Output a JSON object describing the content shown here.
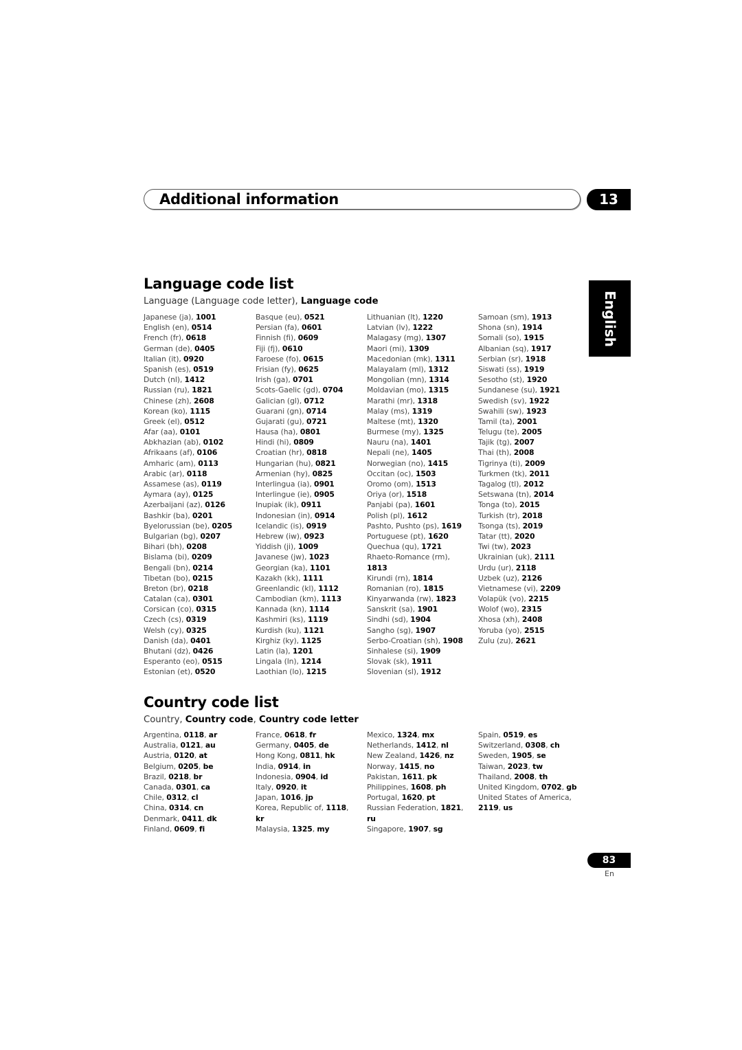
{
  "header": {
    "title": "Additional information",
    "chapter_number": "13"
  },
  "language_tab": "English",
  "language_section": {
    "title": "Language code list",
    "subtitle_plain": "Language (Language code letter), ",
    "subtitle_bold": "Language code",
    "columns": [
      [
        {
          "name": "Japanese (ja), ",
          "code": "1001"
        },
        {
          "name": "English (en), ",
          "code": "0514"
        },
        {
          "name": "French (fr), ",
          "code": "0618"
        },
        {
          "name": "German (de), ",
          "code": "0405"
        },
        {
          "name": "Italian (it), ",
          "code": "0920"
        },
        {
          "name": "Spanish (es), ",
          "code": "0519"
        },
        {
          "name": "Dutch (nl), ",
          "code": "1412"
        },
        {
          "name": "Russian (ru), ",
          "code": "1821"
        },
        {
          "name": "Chinese (zh), ",
          "code": "2608"
        },
        {
          "name": "Korean (ko), ",
          "code": "1115"
        },
        {
          "name": "Greek (el), ",
          "code": "0512"
        },
        {
          "name": "Afar (aa), ",
          "code": "0101"
        },
        {
          "name": "Abkhazian (ab), ",
          "code": "0102"
        },
        {
          "name": "Afrikaans (af), ",
          "code": "0106"
        },
        {
          "name": "Amharic (am), ",
          "code": "0113"
        },
        {
          "name": "Arabic (ar), ",
          "code": "0118"
        },
        {
          "name": "Assamese (as), ",
          "code": "0119"
        },
        {
          "name": "Aymara (ay), ",
          "code": "0125"
        },
        {
          "name": "Azerbaijani (az), ",
          "code": "0126"
        },
        {
          "name": "Bashkir (ba), ",
          "code": "0201"
        },
        {
          "name": "Byelorussian (be), ",
          "code": "0205"
        },
        {
          "name": "Bulgarian (bg), ",
          "code": "0207"
        },
        {
          "name": "Bihari (bh), ",
          "code": "0208"
        },
        {
          "name": "Bislama (bi), ",
          "code": "0209"
        },
        {
          "name": "Bengali (bn), ",
          "code": "0214"
        },
        {
          "name": "Tibetan (bo), ",
          "code": "0215"
        },
        {
          "name": "Breton (br), ",
          "code": "0218"
        },
        {
          "name": "Catalan (ca), ",
          "code": "0301"
        },
        {
          "name": "Corsican (co), ",
          "code": "0315"
        },
        {
          "name": "Czech (cs), ",
          "code": "0319"
        },
        {
          "name": "Welsh (cy), ",
          "code": "0325"
        },
        {
          "name": "Danish (da), ",
          "code": "0401"
        },
        {
          "name": "Bhutani (dz), ",
          "code": "0426"
        },
        {
          "name": "Esperanto (eo), ",
          "code": "0515"
        },
        {
          "name": "Estonian (et), ",
          "code": "0520"
        }
      ],
      [
        {
          "name": "Basque (eu), ",
          "code": "0521"
        },
        {
          "name": "Persian (fa), ",
          "code": "0601"
        },
        {
          "name": "Finnish (fi), ",
          "code": "0609"
        },
        {
          "name": "Fiji (fj), ",
          "code": "0610"
        },
        {
          "name": "Faroese (fo), ",
          "code": "0615"
        },
        {
          "name": "Frisian (fy), ",
          "code": "0625"
        },
        {
          "name": "Irish (ga), ",
          "code": "0701"
        },
        {
          "name": "Scots-Gaelic (gd), ",
          "code": "0704"
        },
        {
          "name": "Galician (gl), ",
          "code": "0712"
        },
        {
          "name": "Guarani (gn), ",
          "code": "0714"
        },
        {
          "name": "Gujarati (gu), ",
          "code": "0721"
        },
        {
          "name": "Hausa (ha), ",
          "code": "0801"
        },
        {
          "name": "Hindi (hi), ",
          "code": "0809"
        },
        {
          "name": "Croatian (hr), ",
          "code": "0818"
        },
        {
          "name": "Hungarian (hu), ",
          "code": "0821"
        },
        {
          "name": "Armenian (hy), ",
          "code": "0825"
        },
        {
          "name": "Interlingua (ia), ",
          "code": "0901"
        },
        {
          "name": "Interlingue (ie), ",
          "code": "0905"
        },
        {
          "name": "Inupiak (ik), ",
          "code": "0911"
        },
        {
          "name": "Indonesian (in), ",
          "code": "0914"
        },
        {
          "name": "Icelandic (is), ",
          "code": "0919"
        },
        {
          "name": "Hebrew (iw), ",
          "code": "0923"
        },
        {
          "name": "Yiddish (ji), ",
          "code": "1009"
        },
        {
          "name": "Javanese (jw), ",
          "code": "1023"
        },
        {
          "name": "Georgian (ka), ",
          "code": "1101"
        },
        {
          "name": "Kazakh (kk), ",
          "code": "1111"
        },
        {
          "name": "Greenlandic  (kl), ",
          "code": "1112"
        },
        {
          "name": "Cambodian (km), ",
          "code": "1113"
        },
        {
          "name": "Kannada (kn), ",
          "code": "1114"
        },
        {
          "name": "Kashmiri (ks), ",
          "code": "1119"
        },
        {
          "name": "Kurdish (ku), ",
          "code": "1121"
        },
        {
          "name": "Kirghiz (ky), ",
          "code": "1125"
        },
        {
          "name": "Latin (la), ",
          "code": "1201"
        },
        {
          "name": "Lingala (ln), ",
          "code": "1214"
        },
        {
          "name": "Laothian (lo), ",
          "code": "1215"
        }
      ],
      [
        {
          "name": "Lithuanian (lt), ",
          "code": "1220"
        },
        {
          "name": "Latvian (lv), ",
          "code": "1222"
        },
        {
          "name": "Malagasy (mg), ",
          "code": "1307"
        },
        {
          "name": "Maori (mi), ",
          "code": "1309"
        },
        {
          "name": "Macedonian (mk), ",
          "code": "1311"
        },
        {
          "name": "Malayalam  (ml), ",
          "code": "1312"
        },
        {
          "name": "Mongolian (mn), ",
          "code": "1314"
        },
        {
          "name": "Moldavian (mo), ",
          "code": "1315"
        },
        {
          "name": "Marathi (mr), ",
          "code": "1318"
        },
        {
          "name": "Malay  (ms), ",
          "code": "1319"
        },
        {
          "name": "Maltese (mt), ",
          "code": "1320"
        },
        {
          "name": "Burmese (my), ",
          "code": "1325"
        },
        {
          "name": "Nauru (na), ",
          "code": "1401"
        },
        {
          "name": "Nepali (ne), ",
          "code": "1405"
        },
        {
          "name": "Norwegian (no), ",
          "code": "1415"
        },
        {
          "name": "Occitan (oc), ",
          "code": "1503"
        },
        {
          "name": "Oromo (om), ",
          "code": "1513"
        },
        {
          "name": "Oriya (or), ",
          "code": "1518"
        },
        {
          "name": "Panjabi (pa), ",
          "code": "1601"
        },
        {
          "name": "Polish (pl), ",
          "code": "1612"
        },
        {
          "name": "Pashto, Pushto (ps), ",
          "code": "1619"
        },
        {
          "name": "Portuguese (pt), ",
          "code": "1620"
        },
        {
          "name": "Quechua (qu), ",
          "code": "1721"
        },
        {
          "name": "Rhaeto-Romance (rm), ",
          "code": "1813",
          "wrap": true
        },
        {
          "name": "Kirundi (rn), ",
          "code": "1814"
        },
        {
          "name": "Romanian (ro), ",
          "code": "1815"
        },
        {
          "name": "Kinyarwanda (rw), ",
          "code": "1823"
        },
        {
          "name": "Sanskrit (sa), ",
          "code": "1901"
        },
        {
          "name": "Sindhi (sd), ",
          "code": "1904"
        },
        {
          "name": "Sangho (sg), ",
          "code": "1907"
        },
        {
          "name": "Serbo-Croatian (sh), ",
          "code": "1908"
        },
        {
          "name": "Sinhalese (si), ",
          "code": "1909"
        },
        {
          "name": "Slovak (sk), ",
          "code": "1911"
        },
        {
          "name": "Slovenian (sl), ",
          "code": "1912"
        }
      ],
      [
        {
          "name": "Samoan (sm), ",
          "code": "1913"
        },
        {
          "name": "Shona (sn), ",
          "code": "1914"
        },
        {
          "name": "Somali (so), ",
          "code": "1915"
        },
        {
          "name": "Albanian (sq), ",
          "code": "1917"
        },
        {
          "name": "Serbian (sr), ",
          "code": "1918"
        },
        {
          "name": "Siswati (ss), ",
          "code": "1919"
        },
        {
          "name": "Sesotho (st), ",
          "code": "1920"
        },
        {
          "name": "Sundanese (su), ",
          "code": "1921"
        },
        {
          "name": "Swedish (sv), ",
          "code": "1922"
        },
        {
          "name": "Swahili (sw), ",
          "code": "1923"
        },
        {
          "name": "Tamil (ta), ",
          "code": "2001"
        },
        {
          "name": "Telugu (te), ",
          "code": "2005"
        },
        {
          "name": "Tajik (tg), ",
          "code": "2007"
        },
        {
          "name": "Thai (th), ",
          "code": "2008"
        },
        {
          "name": "Tigrinya (ti), ",
          "code": "2009"
        },
        {
          "name": "Turkmen (tk), ",
          "code": "2011"
        },
        {
          "name": "Tagalog (tl), ",
          "code": "2012"
        },
        {
          "name": "Setswana (tn), ",
          "code": "2014"
        },
        {
          "name": "Tonga (to), ",
          "code": "2015"
        },
        {
          "name": "Turkish (tr), ",
          "code": "2018"
        },
        {
          "name": "Tsonga (ts), ",
          "code": "2019"
        },
        {
          "name": "Tatar (tt), ",
          "code": "2020"
        },
        {
          "name": "Twi (tw), ",
          "code": "2023"
        },
        {
          "name": "Ukrainian (uk), ",
          "code": "2111"
        },
        {
          "name": "Urdu (ur), ",
          "code": "2118"
        },
        {
          "name": "Uzbek (uz), ",
          "code": "2126"
        },
        {
          "name": "Vietnamese (vi), ",
          "code": "2209"
        },
        {
          "name": "Volapük (vo), ",
          "code": "2215"
        },
        {
          "name": "Wolof (wo), ",
          "code": "2315"
        },
        {
          "name": "Xhosa (xh), ",
          "code": "2408"
        },
        {
          "name": "Yoruba (yo), ",
          "code": "2515"
        },
        {
          "name": "Zulu (zu), ",
          "code": "2621"
        }
      ]
    ]
  },
  "country_section": {
    "title": "Country code list",
    "subtitle_plain": "Country, ",
    "subtitle_bold1": "Country code",
    "subtitle_sep": ", ",
    "subtitle_bold2": "Country code letter",
    "columns": [
      [
        {
          "name": "Argentina, ",
          "code": "0118",
          "letter": "ar"
        },
        {
          "name": "Australia, ",
          "code": "0121",
          "letter": "au"
        },
        {
          "name": "Austria, ",
          "code": "0120",
          "letter": "at"
        },
        {
          "name": "Belgium, ",
          "code": "0205",
          "letter": "be"
        },
        {
          "name": "Brazil, ",
          "code": "0218",
          "letter": "br"
        },
        {
          "name": "Canada, ",
          "code": "0301",
          "letter": "ca"
        },
        {
          "name": "Chile, ",
          "code": "0312",
          "letter": "cl"
        },
        {
          "name": "China, ",
          "code": "0314",
          "letter": "cn"
        },
        {
          "name": "Denmark, ",
          "code": "0411",
          "letter": "dk"
        },
        {
          "name": "Finland, ",
          "code": "0609",
          "letter": "fi"
        }
      ],
      [
        {
          "name": "France, ",
          "code": "0618",
          "letter": "fr"
        },
        {
          "name": "Germany, ",
          "code": "0405",
          "letter": "de"
        },
        {
          "name": "Hong Kong, ",
          "code": "0811",
          "letter": "hk"
        },
        {
          "name": "India, ",
          "code": "0914",
          "letter": "in"
        },
        {
          "name": "Indonesia, ",
          "code": "0904",
          "letter": "id"
        },
        {
          "name": "Italy, ",
          "code": "0920",
          "letter": "it"
        },
        {
          "name": "Japan, ",
          "code": "1016",
          "letter": "jp"
        },
        {
          "name": "Korea, Republic of, ",
          "code": "1118",
          "letter": "kr",
          "wrap": true
        },
        {
          "name": "Malaysia, ",
          "code": "1325",
          "letter": "my"
        }
      ],
      [
        {
          "name": "Mexico, ",
          "code": "1324",
          "letter": "mx"
        },
        {
          "name": "Netherlands, ",
          "code": "1412",
          "letter": "nl"
        },
        {
          "name": "New Zealand, ",
          "code": "1426",
          "letter": "nz"
        },
        {
          "name": "Norway, ",
          "code": "1415",
          "letter": "no"
        },
        {
          "name": "Pakistan, ",
          "code": "1611",
          "letter": "pk"
        },
        {
          "name": "Philippines, ",
          "code": "1608",
          "letter": "ph"
        },
        {
          "name": "Portugal, ",
          "code": "1620",
          "letter": "pt"
        },
        {
          "name": "Russian Federation, ",
          "code": "1821",
          "letter": "ru",
          "wrap": true
        },
        {
          "name": "Singapore, ",
          "code": "1907",
          "letter": "sg"
        }
      ],
      [
        {
          "name": "Spain, ",
          "code": "0519",
          "letter": "es"
        },
        {
          "name": "Switzerland, ",
          "code": "0308",
          "letter": "ch"
        },
        {
          "name": "Sweden, ",
          "code": "1905",
          "letter": "se"
        },
        {
          "name": "Taiwan, ",
          "code": "2023",
          "letter": "tw"
        },
        {
          "name": "Thailand, ",
          "code": "2008",
          "letter": "th"
        },
        {
          "name": "United Kingdom, ",
          "code": "0702",
          "letter": "gb"
        },
        {
          "name": "United States of America, ",
          "code": "2119",
          "letter": "us",
          "wrap": true
        }
      ]
    ]
  },
  "footer": {
    "page_number": "83",
    "language_abbrev": "En"
  }
}
